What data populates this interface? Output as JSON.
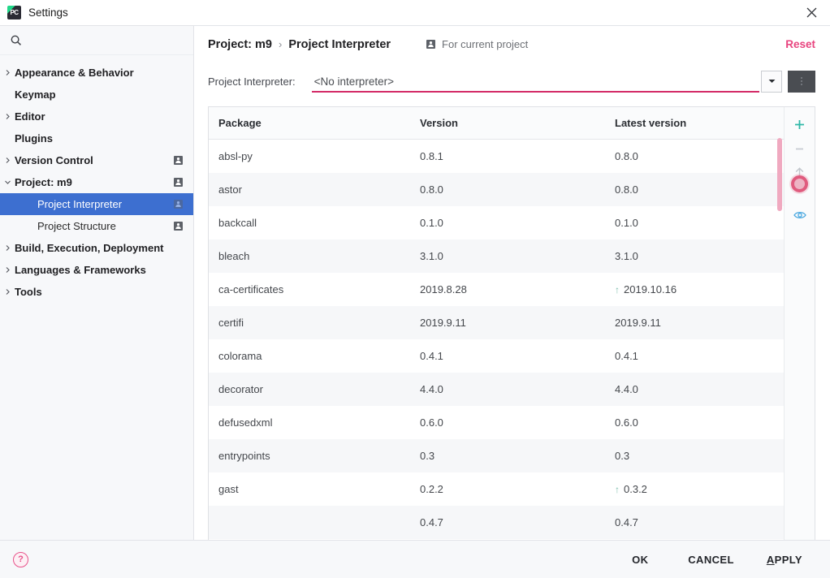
{
  "window": {
    "title": "Settings",
    "logo_text": "PC",
    "close_icon": "close-icon"
  },
  "sidebar": {
    "search": {
      "value": "",
      "placeholder": "",
      "icon": "search-icon"
    },
    "items": [
      {
        "label": "Appearance & Behavior",
        "expandable": true,
        "expanded": false,
        "level": 1,
        "badge": false
      },
      {
        "label": "Keymap",
        "expandable": false,
        "expanded": false,
        "level": 1,
        "badge": false
      },
      {
        "label": "Editor",
        "expandable": true,
        "expanded": false,
        "level": 1,
        "badge": false
      },
      {
        "label": "Plugins",
        "expandable": false,
        "expanded": false,
        "level": 1,
        "badge": false
      },
      {
        "label": "Version Control",
        "expandable": true,
        "expanded": false,
        "level": 1,
        "badge": true
      },
      {
        "label": "Project: m9",
        "expandable": true,
        "expanded": true,
        "level": 1,
        "badge": true
      },
      {
        "label": "Project Interpreter",
        "expandable": false,
        "expanded": false,
        "level": 2,
        "badge": true,
        "selected": true
      },
      {
        "label": "Project Structure",
        "expandable": false,
        "expanded": false,
        "level": 2,
        "badge": true
      },
      {
        "label": "Build, Execution, Deployment",
        "expandable": true,
        "expanded": false,
        "level": 1,
        "badge": false
      },
      {
        "label": "Languages & Frameworks",
        "expandable": true,
        "expanded": false,
        "level": 1,
        "badge": false
      },
      {
        "label": "Tools",
        "expandable": true,
        "expanded": false,
        "level": 1,
        "badge": false
      }
    ]
  },
  "header": {
    "breadcrumb_parent": "Project: m9",
    "breadcrumb_separator": "›",
    "breadcrumb_current": "Project Interpreter",
    "scope_label": "For current project",
    "scope_icon": "user-badge-icon",
    "reset_label": "Reset",
    "reset_color": "#e8447f"
  },
  "interpreter": {
    "label": "Project Interpreter:",
    "value": "<No interpreter>",
    "underline_color": "#d32a66",
    "dropdown_icon": "chevron-down-icon",
    "kebab_icon": "more-options-icon"
  },
  "annotation": {
    "arrow_color": "#1b9ae0",
    "highlight_color": "#1b9ae0"
  },
  "table": {
    "columns": [
      "Package",
      "Version",
      "Latest version"
    ],
    "rows": [
      {
        "package": "absl-py",
        "version": "0.8.1",
        "latest": "0.8.0",
        "upgradable": false
      },
      {
        "package": "astor",
        "version": "0.8.0",
        "latest": "0.8.0",
        "upgradable": false
      },
      {
        "package": "backcall",
        "version": "0.1.0",
        "latest": "0.1.0",
        "upgradable": false
      },
      {
        "package": "bleach",
        "version": "3.1.0",
        "latest": "3.1.0",
        "upgradable": false
      },
      {
        "package": "ca-certificates",
        "version": "2019.8.28",
        "latest": "2019.10.16",
        "upgradable": true
      },
      {
        "package": "certifi",
        "version": "2019.9.11",
        "latest": "2019.9.11",
        "upgradable": false
      },
      {
        "package": "colorama",
        "version": "0.4.1",
        "latest": "0.4.1",
        "upgradable": false
      },
      {
        "package": "decorator",
        "version": "4.4.0",
        "latest": "4.4.0",
        "upgradable": false
      },
      {
        "package": "defusedxml",
        "version": "0.6.0",
        "latest": "0.6.0",
        "upgradable": false
      },
      {
        "package": "entrypoints",
        "version": "0.3",
        "latest": "0.3",
        "upgradable": false
      },
      {
        "package": "gast",
        "version": "0.2.2",
        "latest": "0.3.2",
        "upgradable": true
      },
      {
        "package": "",
        "version": "0.4.7",
        "latest": "0.4.7",
        "upgradable": false
      }
    ],
    "upgrade_marker": "↑"
  },
  "toolbar": {
    "buttons": [
      {
        "name": "add-package-button",
        "icon": "plus-icon",
        "color": "#2fb8a8",
        "enabled": true
      },
      {
        "name": "remove-package-button",
        "icon": "minus-icon",
        "color": "#c8ccd2",
        "enabled": false
      },
      {
        "name": "upgrade-package-button",
        "icon": "arrow-up-icon",
        "color": "#c2c6cc",
        "enabled": false
      },
      {
        "name": "show-early-releases-button",
        "icon": "eye-icon",
        "color": "#4aa8e0",
        "enabled": true
      }
    ]
  },
  "footer": {
    "help_icon": "help-icon",
    "ok_label": "OK",
    "cancel_label": "CANCEL",
    "apply_mnemonic": "A",
    "apply_rest": "PPLY"
  }
}
